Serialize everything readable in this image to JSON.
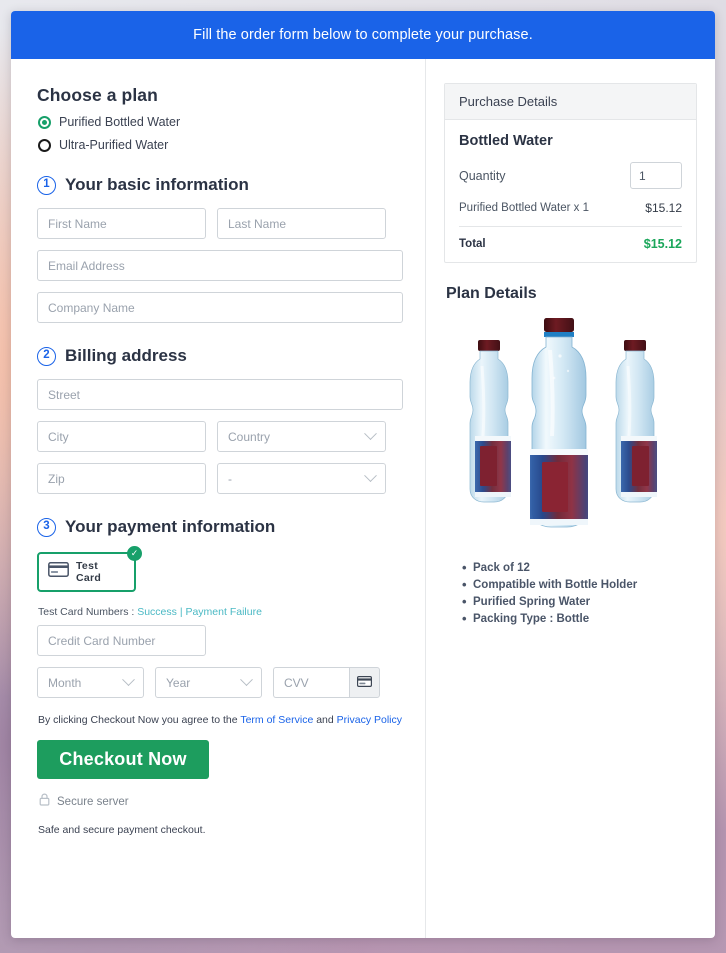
{
  "banner": {
    "text": "Fill the order form below to complete your purchase."
  },
  "plan": {
    "heading": "Choose a plan",
    "options": [
      {
        "label": "Purified Bottled Water",
        "selected": true
      },
      {
        "label": "Ultra-Purified Water",
        "selected": false
      }
    ]
  },
  "steps": {
    "basic": {
      "number": "1",
      "title": "Your basic information"
    },
    "billing": {
      "number": "2",
      "title": "Billing address"
    },
    "payment": {
      "number": "3",
      "title": "Your payment information"
    }
  },
  "fields": {
    "first_name": {
      "placeholder": "First Name",
      "value": ""
    },
    "last_name": {
      "placeholder": "Last Name",
      "value": ""
    },
    "email": {
      "placeholder": "Email Address",
      "value": ""
    },
    "company": {
      "placeholder": "Company Name",
      "value": ""
    },
    "street": {
      "placeholder": "Street",
      "value": ""
    },
    "city": {
      "placeholder": "City",
      "value": ""
    },
    "country": {
      "placeholder": "Country",
      "value": ""
    },
    "zip": {
      "placeholder": "Zip",
      "value": ""
    },
    "state": {
      "placeholder": "-",
      "value": ""
    },
    "card_number": {
      "placeholder": "Credit Card Number",
      "value": ""
    },
    "month": {
      "placeholder": "Month",
      "value": ""
    },
    "year": {
      "placeholder": "Year",
      "value": ""
    },
    "cvv": {
      "placeholder": "CVV",
      "value": ""
    }
  },
  "payment": {
    "tile_label": "Test  Card",
    "tile_selected": true,
    "test_numbers_label": "Test Card Numbers :",
    "link_success": "Success",
    "link_separator": "|",
    "link_failure": "Payment Failure"
  },
  "agreement": {
    "prefix": "By clicking Checkout Now you agree to the",
    "terms_link": "Term of Service",
    "conjunction": "and",
    "privacy_link": "Privacy Policy"
  },
  "checkout": {
    "button_label": "Checkout Now",
    "secure_label": "Secure server",
    "note": "Safe and secure payment checkout."
  },
  "purchase": {
    "panel_title": "Purchase Details",
    "product_name": "Bottled Water",
    "quantity_label": "Quantity",
    "quantity_value": "1",
    "line_item_label": "Purified Bottled Water x 1",
    "line_item_amount": "$15.12",
    "total_label": "Total",
    "total_amount": "$15.12"
  },
  "plan_details": {
    "title": "Plan Details",
    "features": [
      "Pack of 12",
      "Compatible with Bottle Holder",
      "Purified Spring Water",
      "Packing Type : Bottle"
    ]
  },
  "colors": {
    "banner_blue": "#1a63e8",
    "accent_green": "#17a06a",
    "checkout_green": "#1d9d5e",
    "total_green": "#1aa65a",
    "link_teal": "#4bb9c4",
    "link_blue": "#1a63e8"
  }
}
